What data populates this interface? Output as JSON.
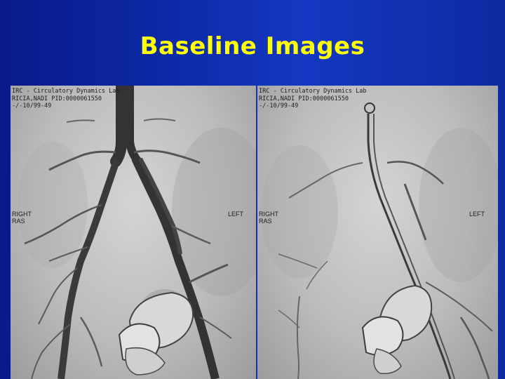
{
  "slide": {
    "title": "Baseline Images"
  },
  "left_image": {
    "header_line1": "IRC - Circulatory Dynamics Lab",
    "header_line2": "RICIA,NADI PID:0000061550",
    "header_line3": "-/-10/99-49",
    "label_right_side": "RIGHT",
    "label_right_side_sub": "RAS",
    "label_left_side": "LEFT"
  },
  "right_image": {
    "header_line1": "IRC - Circulatory Dynamics Lab",
    "header_line2": "RICIA,NADI PID:0000061550",
    "header_line3": "-/-10/99-49",
    "label_right_side": "RIGHT",
    "label_right_side_sub": "RAS",
    "label_left_side": "LEFT"
  }
}
